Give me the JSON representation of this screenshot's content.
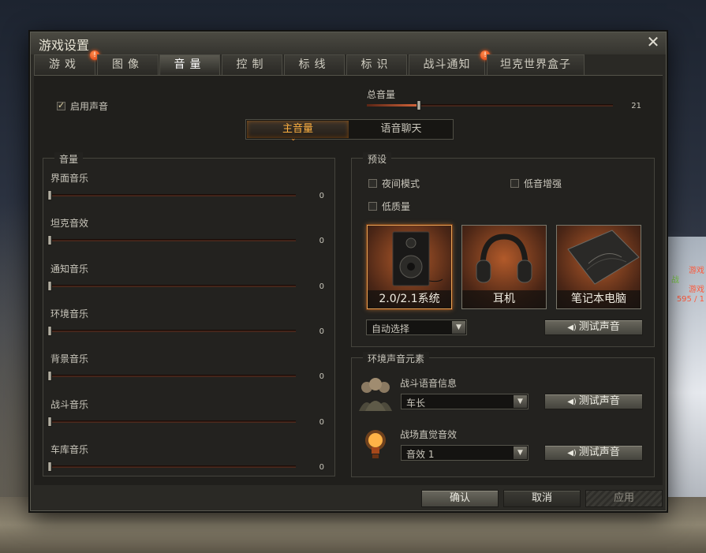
{
  "window": {
    "title": "游戏设置",
    "close_icon": "close-icon"
  },
  "tabs": [
    {
      "label": "游戏",
      "badge": "!"
    },
    {
      "label": "图像"
    },
    {
      "label": "音量"
    },
    {
      "label": "控制"
    },
    {
      "label": "标线"
    },
    {
      "label": "标识"
    },
    {
      "label": "战斗通知",
      "badge": "!"
    },
    {
      "label": "坦克世界盒子"
    }
  ],
  "active_tab": "音量",
  "enable_sound": {
    "label": "启用声音",
    "checked": true
  },
  "master_volume": {
    "label": "总音量",
    "value": "21",
    "level": 0.21
  },
  "segmented": {
    "items": [
      "主音量",
      "语音聊天"
    ],
    "active": "主音量"
  },
  "volume_group": {
    "title": "音量",
    "sliders": [
      {
        "label": "界面音乐",
        "value": "0"
      },
      {
        "label": "坦克音效",
        "value": "0"
      },
      {
        "label": "通知音乐",
        "value": "0"
      },
      {
        "label": "环境音乐",
        "value": "0"
      },
      {
        "label": "背景音乐",
        "value": "0"
      },
      {
        "label": "战斗音乐",
        "value": "0"
      },
      {
        "label": "车库音乐",
        "value": "0"
      }
    ]
  },
  "preset_group": {
    "title": "预设",
    "checkboxes": [
      {
        "label": "夜间模式",
        "checked": false
      },
      {
        "label": "低音增强",
        "checked": false
      },
      {
        "label": "低质量",
        "checked": false
      }
    ],
    "cards": [
      {
        "label": "2.0/2.1系统",
        "icon": "speaker-icon",
        "selected": true
      },
      {
        "label": "耳机",
        "icon": "headphones-icon",
        "selected": false
      },
      {
        "label": "笔记本电脑",
        "icon": "laptop-icon",
        "selected": false
      }
    ],
    "auto_select": "自动选择",
    "test_label": "测试声音"
  },
  "env_group": {
    "title": "环境声音元素",
    "rows": [
      {
        "label": "战斗语音信息",
        "value": "车长",
        "icon": "crew-icon",
        "test_label": "测试声音"
      },
      {
        "label": "战场直觉音效",
        "value": "音效 1",
        "icon": "light-bulb-icon",
        "test_label": "测试声音"
      }
    ]
  },
  "footer": {
    "ok": "确认",
    "cancel": "取消",
    "apply": "应用"
  },
  "colors": {
    "accent": "#ffb040",
    "fill": "#d7663b",
    "badge": "#d93b0c"
  },
  "background_hud": [
    "游戏",
    "战",
    "游戏",
    "595 / 1"
  ]
}
